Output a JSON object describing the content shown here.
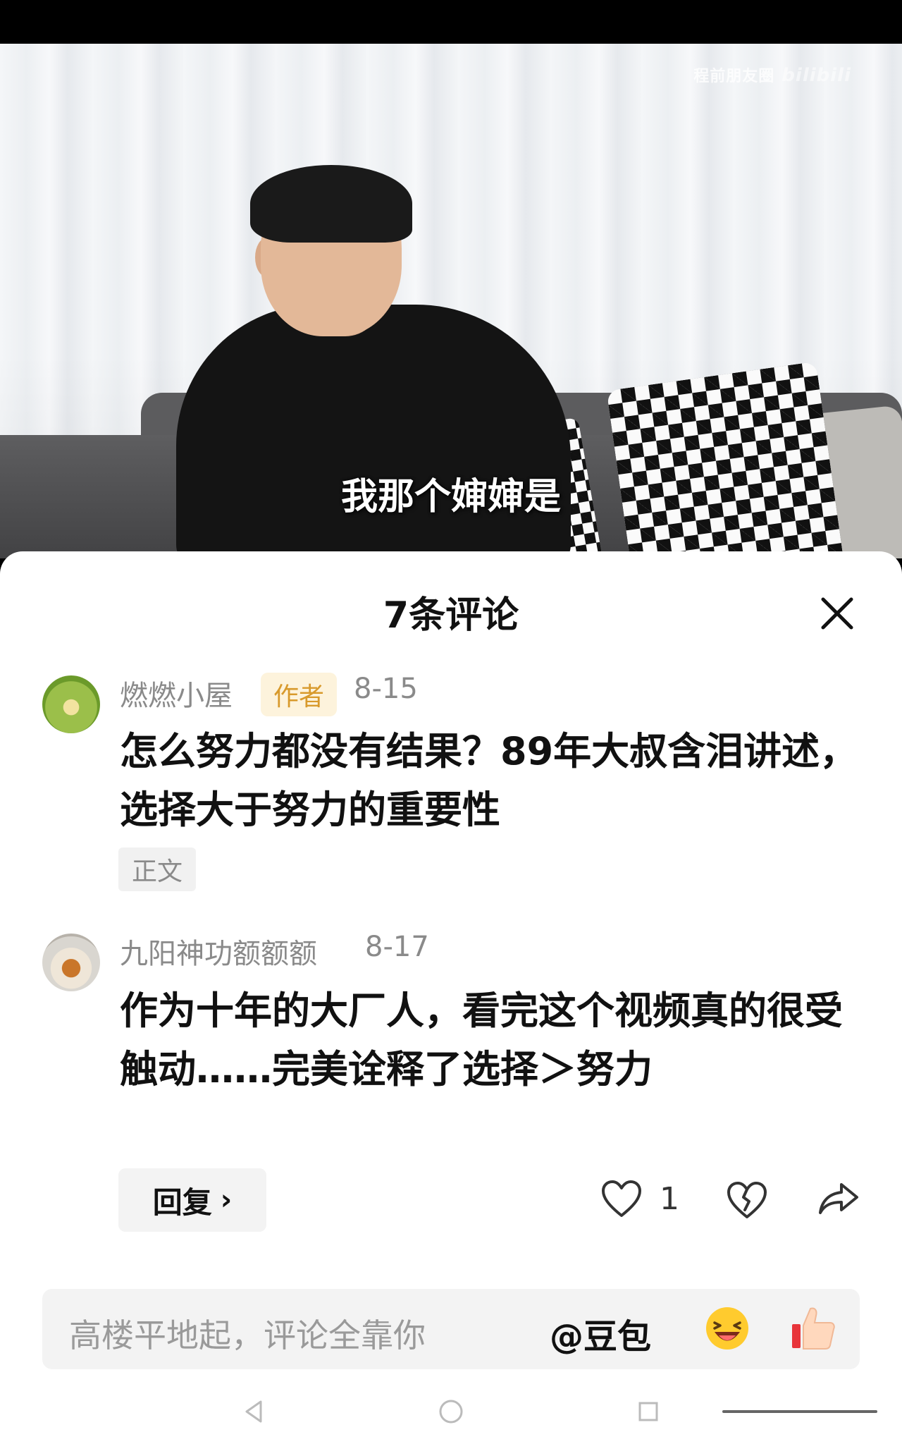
{
  "video": {
    "watermark": "程前朋友圈",
    "watermark_logo": "bilibili",
    "subtitle": "我那个婶婶是"
  },
  "comments_panel": {
    "title": "7条评论",
    "close_icon": "close-icon"
  },
  "comments": [
    {
      "username": "燃燃小屋",
      "badge": "作者",
      "date": "8-15",
      "text": "怎么努力都没有结果？89年大叔含泪讲述，选择大于努力的重要性",
      "tag": "正文"
    },
    {
      "username": "九阳神功额额额",
      "date": "8-17",
      "text": "作为十年的大厂人，看完这个视频真的很受触动……完美诠释了选择＞努力",
      "reply_label": "回复",
      "like_count": "1"
    }
  ],
  "input": {
    "placeholder": "高楼平地起，评论全靠你",
    "mention": "@豆包"
  },
  "icons": {
    "like": "heart-icon",
    "dislike": "broken-heart-icon",
    "share": "share-icon",
    "emoji": "laughing-emoji-icon",
    "thumb": "thumbs-up-icon"
  },
  "colors": {
    "badge_bg": "#fdf3dc",
    "badge_text": "#d89a2c",
    "secondary_text": "#8a8a8a"
  }
}
